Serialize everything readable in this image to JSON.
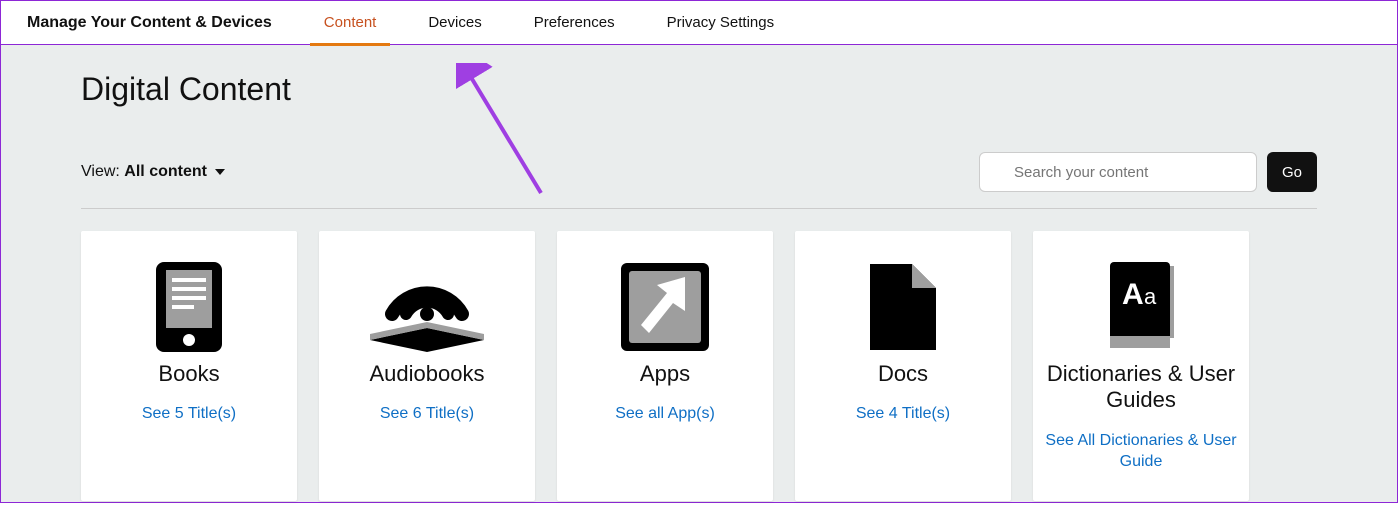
{
  "nav": {
    "title": "Manage Your Content & Devices",
    "tabs": [
      "Content",
      "Devices",
      "Preferences",
      "Privacy Settings"
    ],
    "activeIndex": 0
  },
  "page": {
    "heading": "Digital Content",
    "viewLabel": "View:",
    "viewValue": "All content",
    "searchPlaceholder": "Search your content",
    "goLabel": "Go"
  },
  "cards": [
    {
      "title": "Books",
      "link": "See 5 Title(s)"
    },
    {
      "title": "Audiobooks",
      "link": "See 6 Title(s)"
    },
    {
      "title": "Apps",
      "link": "See all App(s)"
    },
    {
      "title": "Docs",
      "link": "See 4 Title(s)"
    },
    {
      "title": "Dictionaries & User Guides",
      "link": "See All Dictionaries & User Guide"
    }
  ],
  "colors": {
    "accent": "#e47911",
    "link": "#0f6fc5",
    "frame": "#8d27d6",
    "arrow": "#9f3fe2"
  }
}
